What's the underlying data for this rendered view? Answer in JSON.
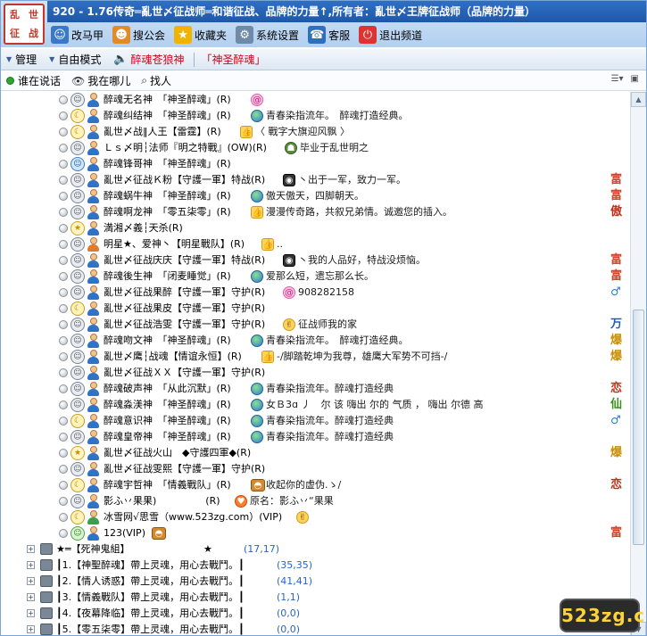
{
  "title": "920 - 1.76传奇═亂世〆征战师═和谐征战、品牌的力量↑,所有者：亂世〆王牌征战师（品牌的力量）",
  "logo_text": [
    "乱",
    "世",
    "征",
    "战"
  ],
  "toolbar": [
    {
      "label": "改马甲",
      "icon": "vest-icon"
    },
    {
      "label": "搜公会",
      "icon": "guild-search-icon"
    },
    {
      "label": "收藏夹",
      "icon": "star-icon"
    },
    {
      "label": "系统设置",
      "icon": "settings-icon"
    },
    {
      "label": "客服",
      "icon": "support-icon"
    },
    {
      "label": "退出频道",
      "icon": "power-icon"
    }
  ],
  "modebar": {
    "manage": "管理",
    "free_mode": "自由模式",
    "speaker_name": "醉魂苍狼神",
    "speaker_tag": "「神圣醉魂」"
  },
  "subbar": {
    "who_speaking": "谁在说话",
    "where_am_i": "我在哪儿",
    "find_person": "找人"
  },
  "members": [
    {
      "face": "gray",
      "avatar": "blue",
      "name": "醉魂无名神　「神圣醉魂」(R)",
      "icon": "swirl",
      "msg": "",
      "badge": ""
    },
    {
      "face": "moon",
      "avatar": "blue",
      "name": "醉魂纠结神　「神圣醉魂」(R)",
      "icon": "globe",
      "msg": "青春染指流年。　醉魂打造经典。",
      "badge": ""
    },
    {
      "face": "moon",
      "avatar": "blue",
      "name": "亂世〆战‖人王【雷霆】(R)",
      "icon": "thumb",
      "msg": "〈 戰字大旗迎风飘 〉",
      "badge": ""
    },
    {
      "face": "gray",
      "avatar": "blue",
      "name": "Ｌｓ〆明┆法师『明之特戰』(OW)(R)",
      "icon": "hat",
      "msg": "毕业于乱世明之",
      "badge": ""
    },
    {
      "face": "blue",
      "avatar": "blue",
      "name": "醉魂锋哥神　「神圣醉魂」(R)",
      "icon": "",
      "msg": "",
      "badge": ""
    },
    {
      "face": "gray",
      "avatar": "blue",
      "name": "亂世〆征战Ｋ粉【守護一軍】特战(R)",
      "icon": "bubble",
      "msg": "丶出于一军，致力一军。",
      "badge": "富"
    },
    {
      "face": "gray",
      "avatar": "blue",
      "name": "醉魂蜗牛神　「神圣醉魂」(R)",
      "icon": "globe",
      "msg": "傲天傲天，四脚朝天。",
      "badge": "富"
    },
    {
      "face": "gray",
      "avatar": "blue",
      "name": "醉魂啊龙神　「零五柒零」(R)",
      "icon": "thumb",
      "msg": "漫漫传奇路，共叙兄弟情。诚邀您的插入。",
      "badge": "傲"
    },
    {
      "face": "star",
      "avatar": "blue",
      "name": "満湘〆義┆天杀(R)",
      "icon": "",
      "msg": "",
      "badge": ""
    },
    {
      "face": "gray",
      "avatar": "orange",
      "name": "明星★、爱神丶【明星戰队】(R)",
      "icon": "thumb",
      "msg": "..",
      "badge": ""
    },
    {
      "face": "gray",
      "avatar": "blue",
      "name": "亂世〆征战庆庆【守護一軍】特战(R)",
      "icon": "bubble",
      "msg": "丶我的人品好，特战没烦恼。",
      "badge": "富"
    },
    {
      "face": "gray",
      "avatar": "blue",
      "name": "醉魂後生神　「闭麦睡觉」(R)",
      "icon": "globe",
      "msg": "爱那么短，遗忘那么长。",
      "badge": "富"
    },
    {
      "face": "gray",
      "avatar": "blue",
      "name": "亂世〆征战果醉【守護一軍】守护(R)",
      "icon": "swirl",
      "msg": "908282158",
      "badge": "♂"
    },
    {
      "face": "moon",
      "avatar": "blue",
      "name": "亂世〆征战果皮【守護一軍】守护(R)",
      "icon": "",
      "msg": "",
      "badge": ""
    },
    {
      "face": "gray",
      "avatar": "blue",
      "name": "亂世〆征战浩雯【守護一軍】守护(R)",
      "icon": "victory",
      "msg": "征战师我的家",
      "badge": "万"
    },
    {
      "face": "gray",
      "avatar": "blue",
      "name": "醉魂吻文神　「神圣醉魂」(R)",
      "icon": "globe",
      "msg": "青春染指流年。　醉魂打造经典。",
      "badge": "爆"
    },
    {
      "face": "gray",
      "avatar": "blue",
      "name": "亂世〆鹰┆战魂【情谊永恒】(R)",
      "icon": "thumb",
      "msg": "-∕脚踏乾坤为我尊，雄鹰大军势不可挡-∕",
      "badge": "爆"
    },
    {
      "face": "gray",
      "avatar": "blue",
      "name": "亂世〆征战ＸＸ【守護一軍】守护(R)",
      "icon": "",
      "msg": "",
      "badge": ""
    },
    {
      "face": "gray",
      "avatar": "blue",
      "name": "醉魂破声神　「从此沉默」(R)",
      "icon": "globe",
      "msg": "青春染指流年。醉魂打造经典",
      "badge": "恋"
    },
    {
      "face": "gray",
      "avatar": "blue",
      "name": "醉魂淼渼神　「神圣醉魂」(R)",
      "icon": "globe",
      "msg": "女Ｂ3ɑ 丿　尔 该 嗨出 尔的 气质 ， 嗨出 尔德 高",
      "badge": "仙"
    },
    {
      "face": "moon",
      "avatar": "blue",
      "name": "醉魂意识神　「神圣醉魂」(R)",
      "icon": "globe",
      "msg": "青春染指流年。醉魂打造经典",
      "badge": "♂"
    },
    {
      "face": "gray",
      "avatar": "blue",
      "name": "醉魂皇帝神　「神圣醉魂」(R)",
      "icon": "globe",
      "msg": "青春染指流年。醉魂打造经典",
      "badge": ""
    },
    {
      "face": "star",
      "avatar": "blue",
      "name": "亂世〆征战火山　◆守護四軍◆(R)",
      "icon": "",
      "msg": "",
      "badge": "爆"
    },
    {
      "face": "gray",
      "avatar": "blue",
      "name": "亂世〆征战雯熙【守護一軍】守护(R)",
      "icon": "",
      "msg": "",
      "badge": ""
    },
    {
      "face": "moon",
      "avatar": "blue",
      "name": "醉魂宇哲神　「情義戰队」(R)",
      "icon": "orb",
      "msg": "收起你的虚伪.ゝ∕",
      "badge": "恋"
    },
    {
      "face": "gray",
      "avatar": "blue",
      "name": "影ふ丷果果)　　　　　(R)",
      "icon": "heart",
      "msg": "原名：影ふ丷“果果",
      "badge": ""
    },
    {
      "face": "moon",
      "avatar": "green",
      "name": "冰雪网√思雪（www.523zg.com）(VIP)",
      "icon": "victory",
      "msg": "",
      "badge": ""
    },
    {
      "face": "green",
      "avatar": "blue",
      "name": "123(VIP)",
      "icon": "orb",
      "msg": "",
      "badge": "富"
    }
  ],
  "groups": [
    {
      "name": "★═【死神鬼組】　　　　　　　　★",
      "count": "(17,17)"
    },
    {
      "name": "┃1.【神聖醉魂】帶上灵魂，用心去戰鬥。┃",
      "count": "(35,35)"
    },
    {
      "name": "┃2.【情人诱惑】帶上灵魂，用心去戰鬥。┃",
      "count": "(41,41)"
    },
    {
      "name": "┃3.【情義戰队】帶上灵魂，用心去戰鬥。┃",
      "count": "(1,1)"
    },
    {
      "name": "┃4.【夜幕降临】帶上灵魂，用心去戰鬥。┃",
      "count": "(0,0)"
    },
    {
      "name": "┃5.【零五柒零】帶上灵魂，用心去戰鬥。┃",
      "count": "(0,0)"
    }
  ],
  "watermark": "523zg.com"
}
